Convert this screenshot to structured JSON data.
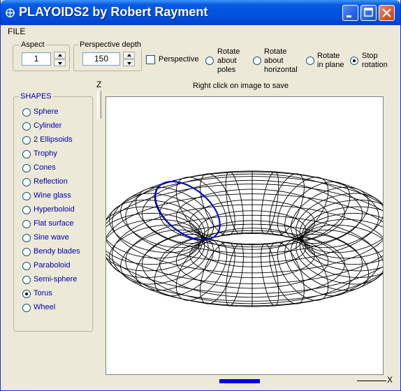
{
  "window": {
    "title": "PLAYOIDS2 by Robert Rayment",
    "buttons": [
      "minimize",
      "maximize",
      "close"
    ]
  },
  "menu": {
    "file_label": "FILE"
  },
  "aspect": {
    "label": "Aspect",
    "value": "1"
  },
  "perspective_depth": {
    "label": "Perspective depth",
    "value": "150"
  },
  "perspective_checkbox": {
    "label": "Perspective",
    "checked": false
  },
  "rotation_options": [
    {
      "label": "Rotate about poles",
      "lines": [
        "Rotate",
        "about",
        "poles"
      ],
      "checked": false
    },
    {
      "label": "Rotate about horizontal",
      "lines": [
        "Rotate",
        "about",
        "horizontal"
      ],
      "checked": false
    },
    {
      "label": "Rotate in plane",
      "lines": [
        "Rotate",
        "in plane"
      ],
      "checked": false
    },
    {
      "label": "Stop rotation",
      "lines": [
        "Stop",
        "rotation"
      ],
      "checked": true
    }
  ],
  "canvas": {
    "hint": "Right click on image to save"
  },
  "axes": {
    "z": "Z",
    "x": "X"
  },
  "shapes": {
    "title": "SHAPES",
    "items": [
      {
        "label": "Sphere",
        "checked": false
      },
      {
        "label": "Cylinder",
        "checked": false
      },
      {
        "label": "2 Ellipsoids",
        "checked": false
      },
      {
        "label": "Trophy",
        "checked": false
      },
      {
        "label": "Cones",
        "checked": false
      },
      {
        "label": "Reflection",
        "checked": false
      },
      {
        "label": "Wine glass",
        "checked": false
      },
      {
        "label": "Hyperboloid",
        "checked": false
      },
      {
        "label": "Flat surface",
        "checked": false
      },
      {
        "label": "Sine wave",
        "checked": false
      },
      {
        "label": "Bendy blades",
        "checked": false
      },
      {
        "label": "Paraboloid",
        "checked": false
      },
      {
        "label": "Semi-sphere",
        "checked": false
      },
      {
        "label": "Torus",
        "checked": true
      },
      {
        "label": "Wheel",
        "checked": false
      }
    ]
  },
  "colors": {
    "title_bar": "#0054e3",
    "shape_label": "#0000aa",
    "highlight_ellipse": "#0000cc",
    "x_slider": "#0000ee"
  }
}
